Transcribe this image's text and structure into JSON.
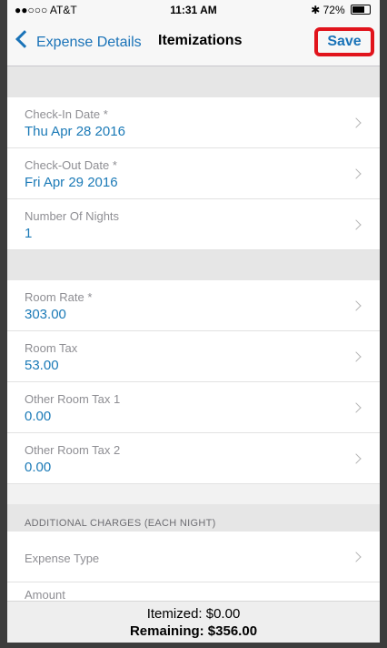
{
  "status_bar": {
    "carrier": "●●○○○ AT&T",
    "wifi": "wifi-icon",
    "time": "11:31 AM",
    "bluetooth": "bluetooth-icon",
    "battery_text": "72%",
    "battery_level": 0.72
  },
  "nav": {
    "back_label": "Expense Details",
    "title": "Itemizations",
    "save_label": "Save",
    "accent_color": "#1a73b8",
    "highlight_color": "#e1141c"
  },
  "dates_section": [
    {
      "label": "Check-In Date *",
      "value": "Thu Apr 28 2016"
    },
    {
      "label": "Check-Out Date *",
      "value": "Fri Apr 29 2016"
    },
    {
      "label": "Number Of Nights",
      "value": "1"
    }
  ],
  "room_section": [
    {
      "label": "Room Rate *",
      "value": "303.00"
    },
    {
      "label": "Room Tax",
      "value": "53.00"
    },
    {
      "label": "Other Room Tax 1",
      "value": "0.00"
    },
    {
      "label": "Other Room Tax 2",
      "value": "0.00"
    }
  ],
  "additional": {
    "header": "ADDITIONAL CHARGES (EACH NIGHT)",
    "expense_type_label": "Expense Type",
    "amount_label_partial": "Amount"
  },
  "footer": {
    "itemized": "Itemized: $0.00",
    "remaining": "Remaining: $356.00"
  }
}
